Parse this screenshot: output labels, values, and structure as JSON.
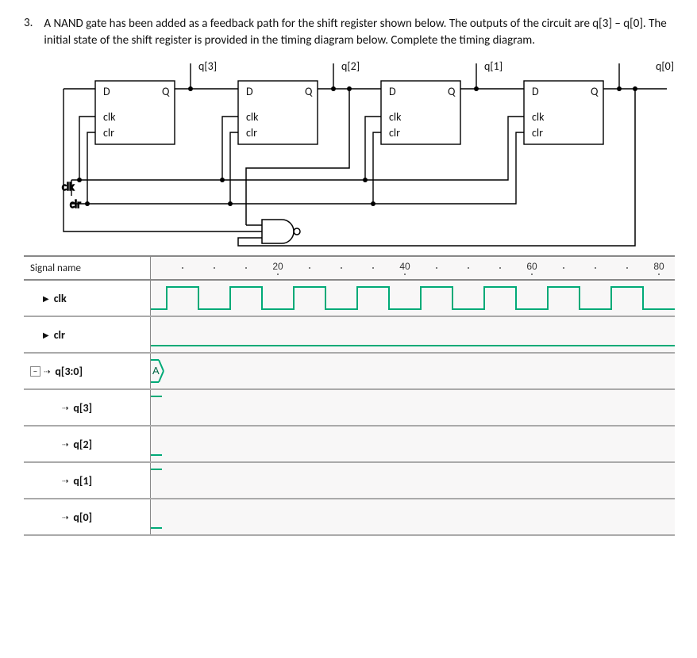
{
  "question": {
    "number": "3.",
    "text": "A NAND gate has been added as a feedback path for the shift register shown below. The outputs of the circuit are q[3] – q[0]. The initial state of the shift register is provided in the timing diagram below. Complete the timing diagram."
  },
  "circuit": {
    "outputs": [
      "q[3]",
      "q[2]",
      "q[1]",
      "q[0]"
    ],
    "ff_labels": {
      "D": "D",
      "Q": "Q",
      "clk": "clk",
      "clr": "clr"
    },
    "global_clk": "clk",
    "global_clr": "clr"
  },
  "timing": {
    "header": "Signal name",
    "ticks": [
      "20",
      "40",
      "60",
      "80"
    ],
    "rows": [
      {
        "label": "clk",
        "indent": 1,
        "bold": true
      },
      {
        "label": "clr",
        "indent": 1,
        "bold": true
      },
      {
        "label": "q[3:0]",
        "indent": 0,
        "bold": true,
        "expand": true,
        "bus_start": "A"
      },
      {
        "label": "q[3]",
        "indent": 2,
        "bold": true
      },
      {
        "label": "q[2]",
        "indent": 2,
        "bold": true
      },
      {
        "label": "q[1]",
        "indent": 2,
        "bold": true
      },
      {
        "label": "q[0]",
        "indent": 2,
        "bold": true
      }
    ]
  }
}
